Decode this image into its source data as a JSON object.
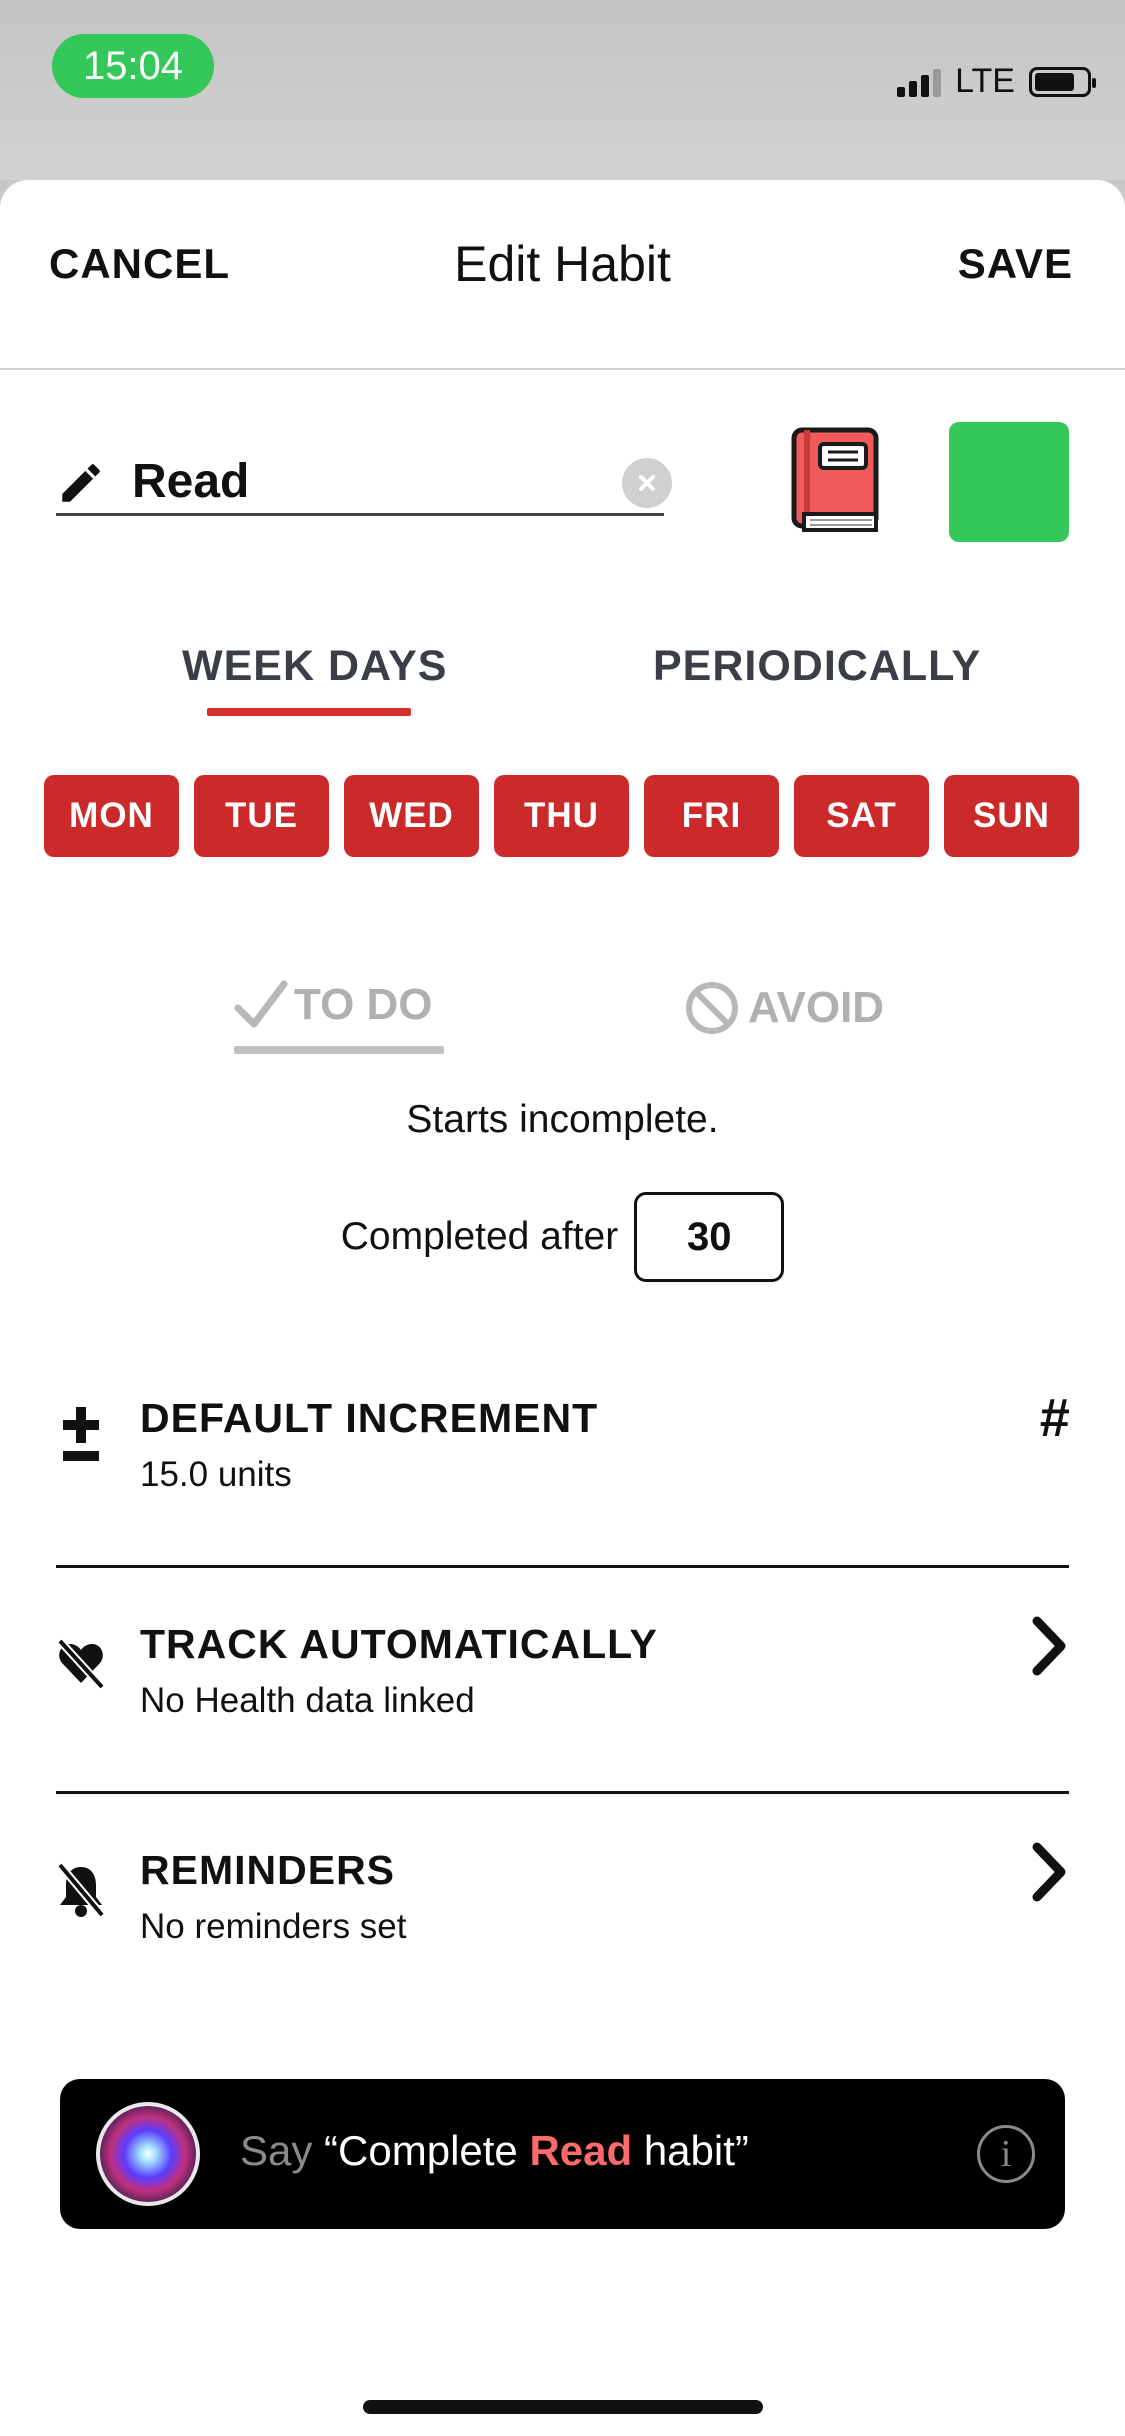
{
  "status": {
    "time": "15:04",
    "network": "LTE"
  },
  "nav": {
    "cancel": "CANCEL",
    "title": "Edit Habit",
    "save": "SAVE"
  },
  "habit": {
    "name": "Read",
    "icon": "book-icon",
    "color": "#34c759"
  },
  "schedule": {
    "tabs": [
      "WEEK DAYS",
      "PERIODICALLY"
    ],
    "selected_tab": "WEEK DAYS",
    "days": [
      "MON",
      "TUE",
      "WED",
      "THU",
      "FRI",
      "SAT",
      "SUN"
    ],
    "day_color": "#cc2a2a"
  },
  "type": {
    "todo": "TO DO",
    "avoid": "AVOID",
    "selected": "TO DO"
  },
  "starts_text": "Starts incomplete.",
  "completed": {
    "label": "Completed after",
    "value": "30"
  },
  "settings": {
    "increment": {
      "title": "DEFAULT INCREMENT",
      "subtitle": "15.0 units",
      "right": "#"
    },
    "track": {
      "title": "TRACK AUTOMATICALLY",
      "subtitle": "No Health data linked"
    },
    "reminders": {
      "title": "REMINDERS",
      "subtitle": "No reminders set"
    }
  },
  "siri": {
    "say": "Say",
    "open_quote": " “Complete ",
    "habit": "Read",
    "close_quote": " habit”"
  }
}
